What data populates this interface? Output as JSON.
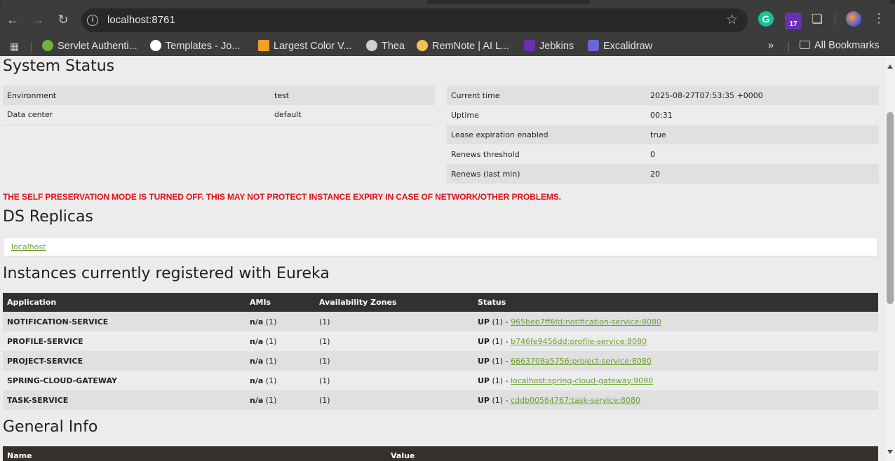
{
  "browser": {
    "url": "localhost:8761",
    "ext_badge": "17",
    "bookmarks": [
      {
        "label": "Servlet Authenti...",
        "color": "#6db33f"
      },
      {
        "label": "Templates - Jo...",
        "color": "#ffffff"
      },
      {
        "label": "Largest Color V...",
        "color": "#f4a024"
      },
      {
        "label": "Thea",
        "color": "#cfcfcf"
      },
      {
        "label": "RemNote | AI L...",
        "color": "#f2c14e"
      },
      {
        "label": "Jebkins",
        "color": "#6b2fb3"
      },
      {
        "label": "Excalidraw",
        "color": "#6965db"
      }
    ],
    "overflow": "»",
    "all_bookmarks": "All Bookmarks"
  },
  "system_status": {
    "title": "System Status",
    "left": [
      {
        "key": "Environment",
        "value": "test"
      },
      {
        "key": "Data center",
        "value": "default"
      }
    ],
    "right": [
      {
        "key": "Current time",
        "value": "2025-08-27T07:53:35 +0000"
      },
      {
        "key": "Uptime",
        "value": "00:31"
      },
      {
        "key": "Lease expiration enabled",
        "value": "true"
      },
      {
        "key": "Renews threshold",
        "value": "0"
      },
      {
        "key": "Renews (last min)",
        "value": "20"
      }
    ]
  },
  "warning": "THE SELF PRESERVATION MODE IS TURNED OFF. THIS MAY NOT PROTECT INSTANCE EXPIRY IN CASE OF NETWORK/OTHER PROBLEMS.",
  "ds_replicas": {
    "title": "DS Replicas",
    "link": "localhost"
  },
  "instances": {
    "title": "Instances currently registered with Eureka",
    "headers": [
      "Application",
      "AMIs",
      "Availability Zones",
      "Status"
    ],
    "rows": [
      {
        "app": "NOTIFICATION-SERVICE",
        "ami": "n/a",
        "ami_count": "(1)",
        "zones": "(1)",
        "status": "UP",
        "status_count": "(1) -",
        "instance": "965beb7ff6fd:notification-service:8080"
      },
      {
        "app": "PROFILE-SERVICE",
        "ami": "n/a",
        "ami_count": "(1)",
        "zones": "(1)",
        "status": "UP",
        "status_count": "(1) -",
        "instance": "b746fe9456dd:profile-service:8080"
      },
      {
        "app": "PROJECT-SERVICE",
        "ami": "n/a",
        "ami_count": "(1)",
        "zones": "(1)",
        "status": "UP",
        "status_count": "(1) -",
        "instance": "6663708a5756:project-service:8080"
      },
      {
        "app": "SPRING-CLOUD-GATEWAY",
        "ami": "n/a",
        "ami_count": "(1)",
        "zones": "(1)",
        "status": "UP",
        "status_count": "(1) -",
        "instance": "localhost:spring-cloud-gateway:9090"
      },
      {
        "app": "TASK-SERVICE",
        "ami": "n/a",
        "ami_count": "(1)",
        "zones": "(1)",
        "status": "UP",
        "status_count": "(1) -",
        "instance": "cddb00564767:task-service:8080"
      }
    ]
  },
  "general_info": {
    "title": "General Info",
    "headers": [
      "Name",
      "Value"
    ]
  }
}
